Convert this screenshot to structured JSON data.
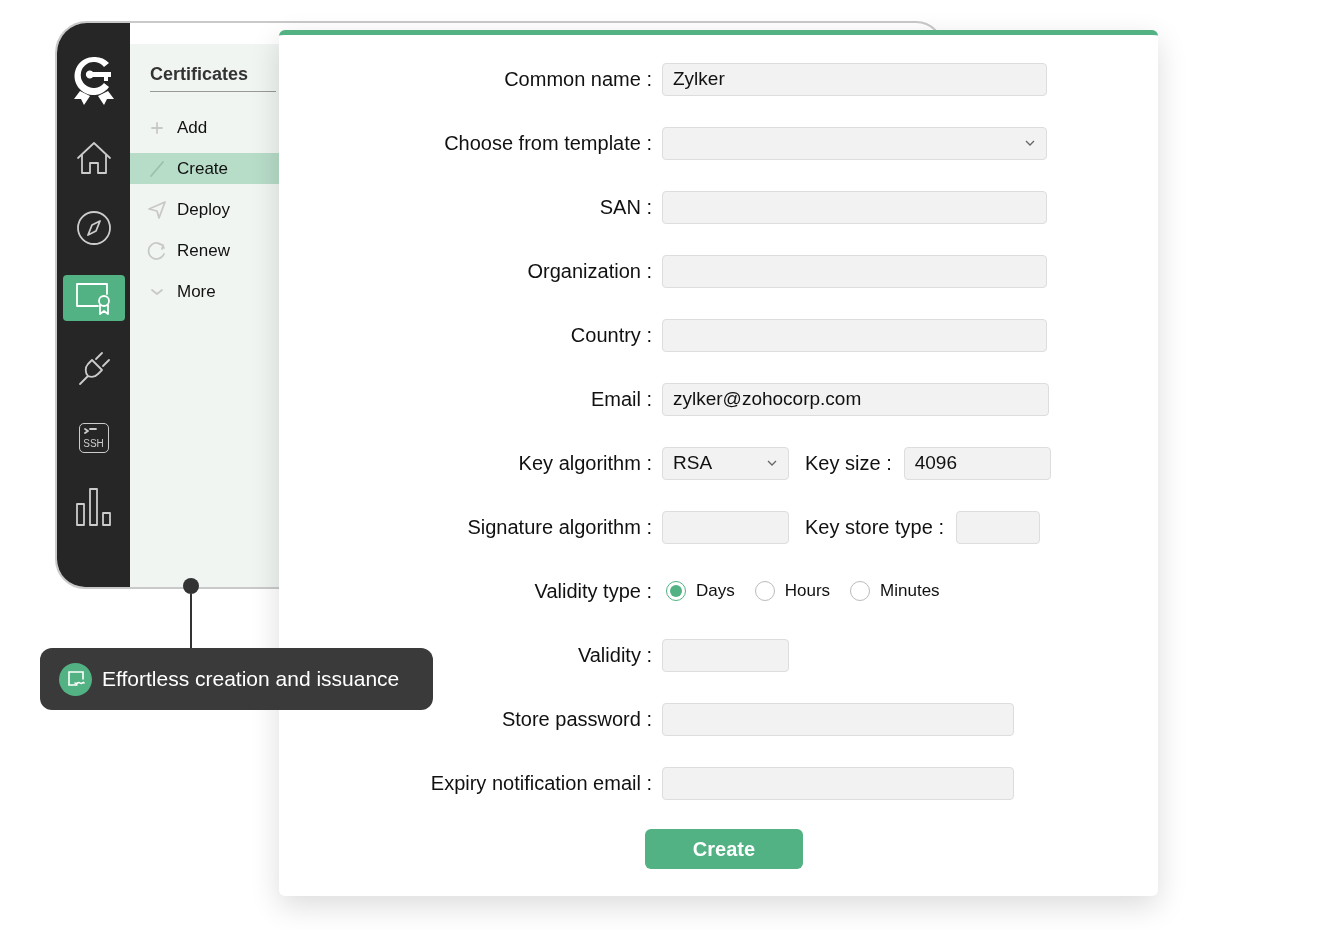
{
  "app_window": {
    "rail": [
      {
        "kind": "logo",
        "selected": false
      },
      {
        "kind": "home",
        "selected": false
      },
      {
        "kind": "compass",
        "selected": false
      },
      {
        "kind": "certificate",
        "selected": true
      },
      {
        "kind": "plug",
        "selected": false
      },
      {
        "kind": "ssh",
        "label": "SSH",
        "selected": false
      },
      {
        "kind": "chart",
        "selected": false
      }
    ],
    "sidebar": {
      "title": "Certificates",
      "items": [
        {
          "kind": "add",
          "label": "Add",
          "selected": false
        },
        {
          "kind": "create",
          "label": "Create",
          "selected": true
        },
        {
          "kind": "deploy",
          "label": "Deploy",
          "selected": false
        },
        {
          "kind": "renew",
          "label": "Renew",
          "selected": false
        },
        {
          "kind": "more",
          "label": "More",
          "selected": false
        }
      ]
    }
  },
  "form": {
    "rows": [
      {
        "label": "Common name :",
        "controls": [
          {
            "kind": "text",
            "value": "Zylker"
          }
        ]
      },
      {
        "label": "Choose from template :",
        "controls": [
          {
            "kind": "select"
          }
        ]
      },
      {
        "label": "SAN :",
        "controls": [
          {
            "kind": "text"
          }
        ]
      },
      {
        "label": "Organization :",
        "controls": [
          {
            "kind": "text"
          }
        ]
      },
      {
        "label": "Country :",
        "controls": [
          {
            "kind": "text"
          }
        ]
      },
      {
        "label": "Email :",
        "controls": [
          {
            "kind": "text",
            "value": "zylker@zohocorp.com"
          }
        ]
      },
      {
        "label": "Key algorithm :",
        "controls": [
          {
            "kind": "select",
            "value": "RSA"
          },
          {
            "kind": "label",
            "text": "Key size :"
          },
          {
            "kind": "text",
            "value": "4096"
          }
        ]
      },
      {
        "label": "Signature algorithm :",
        "controls": [
          {
            "kind": "text"
          },
          {
            "kind": "label",
            "text": "Key store type :"
          },
          {
            "kind": "text"
          }
        ]
      },
      {
        "label": "Validity type :",
        "controls": [
          {
            "kind": "radio",
            "label": "Days",
            "selected": true
          },
          {
            "kind": "radio",
            "label": "Hours",
            "selected": false
          },
          {
            "kind": "radio",
            "label": "Minutes",
            "selected": false
          }
        ]
      },
      {
        "label": "Validity :",
        "controls": [
          {
            "kind": "text"
          }
        ]
      },
      {
        "label": "Store password :",
        "controls": [
          {
            "kind": "password"
          }
        ]
      },
      {
        "label": "Expiry notification email :",
        "controls": [
          {
            "kind": "text"
          }
        ]
      }
    ],
    "submit": "Create"
  },
  "callout": {
    "text": "Effortless creation and issuance"
  }
}
